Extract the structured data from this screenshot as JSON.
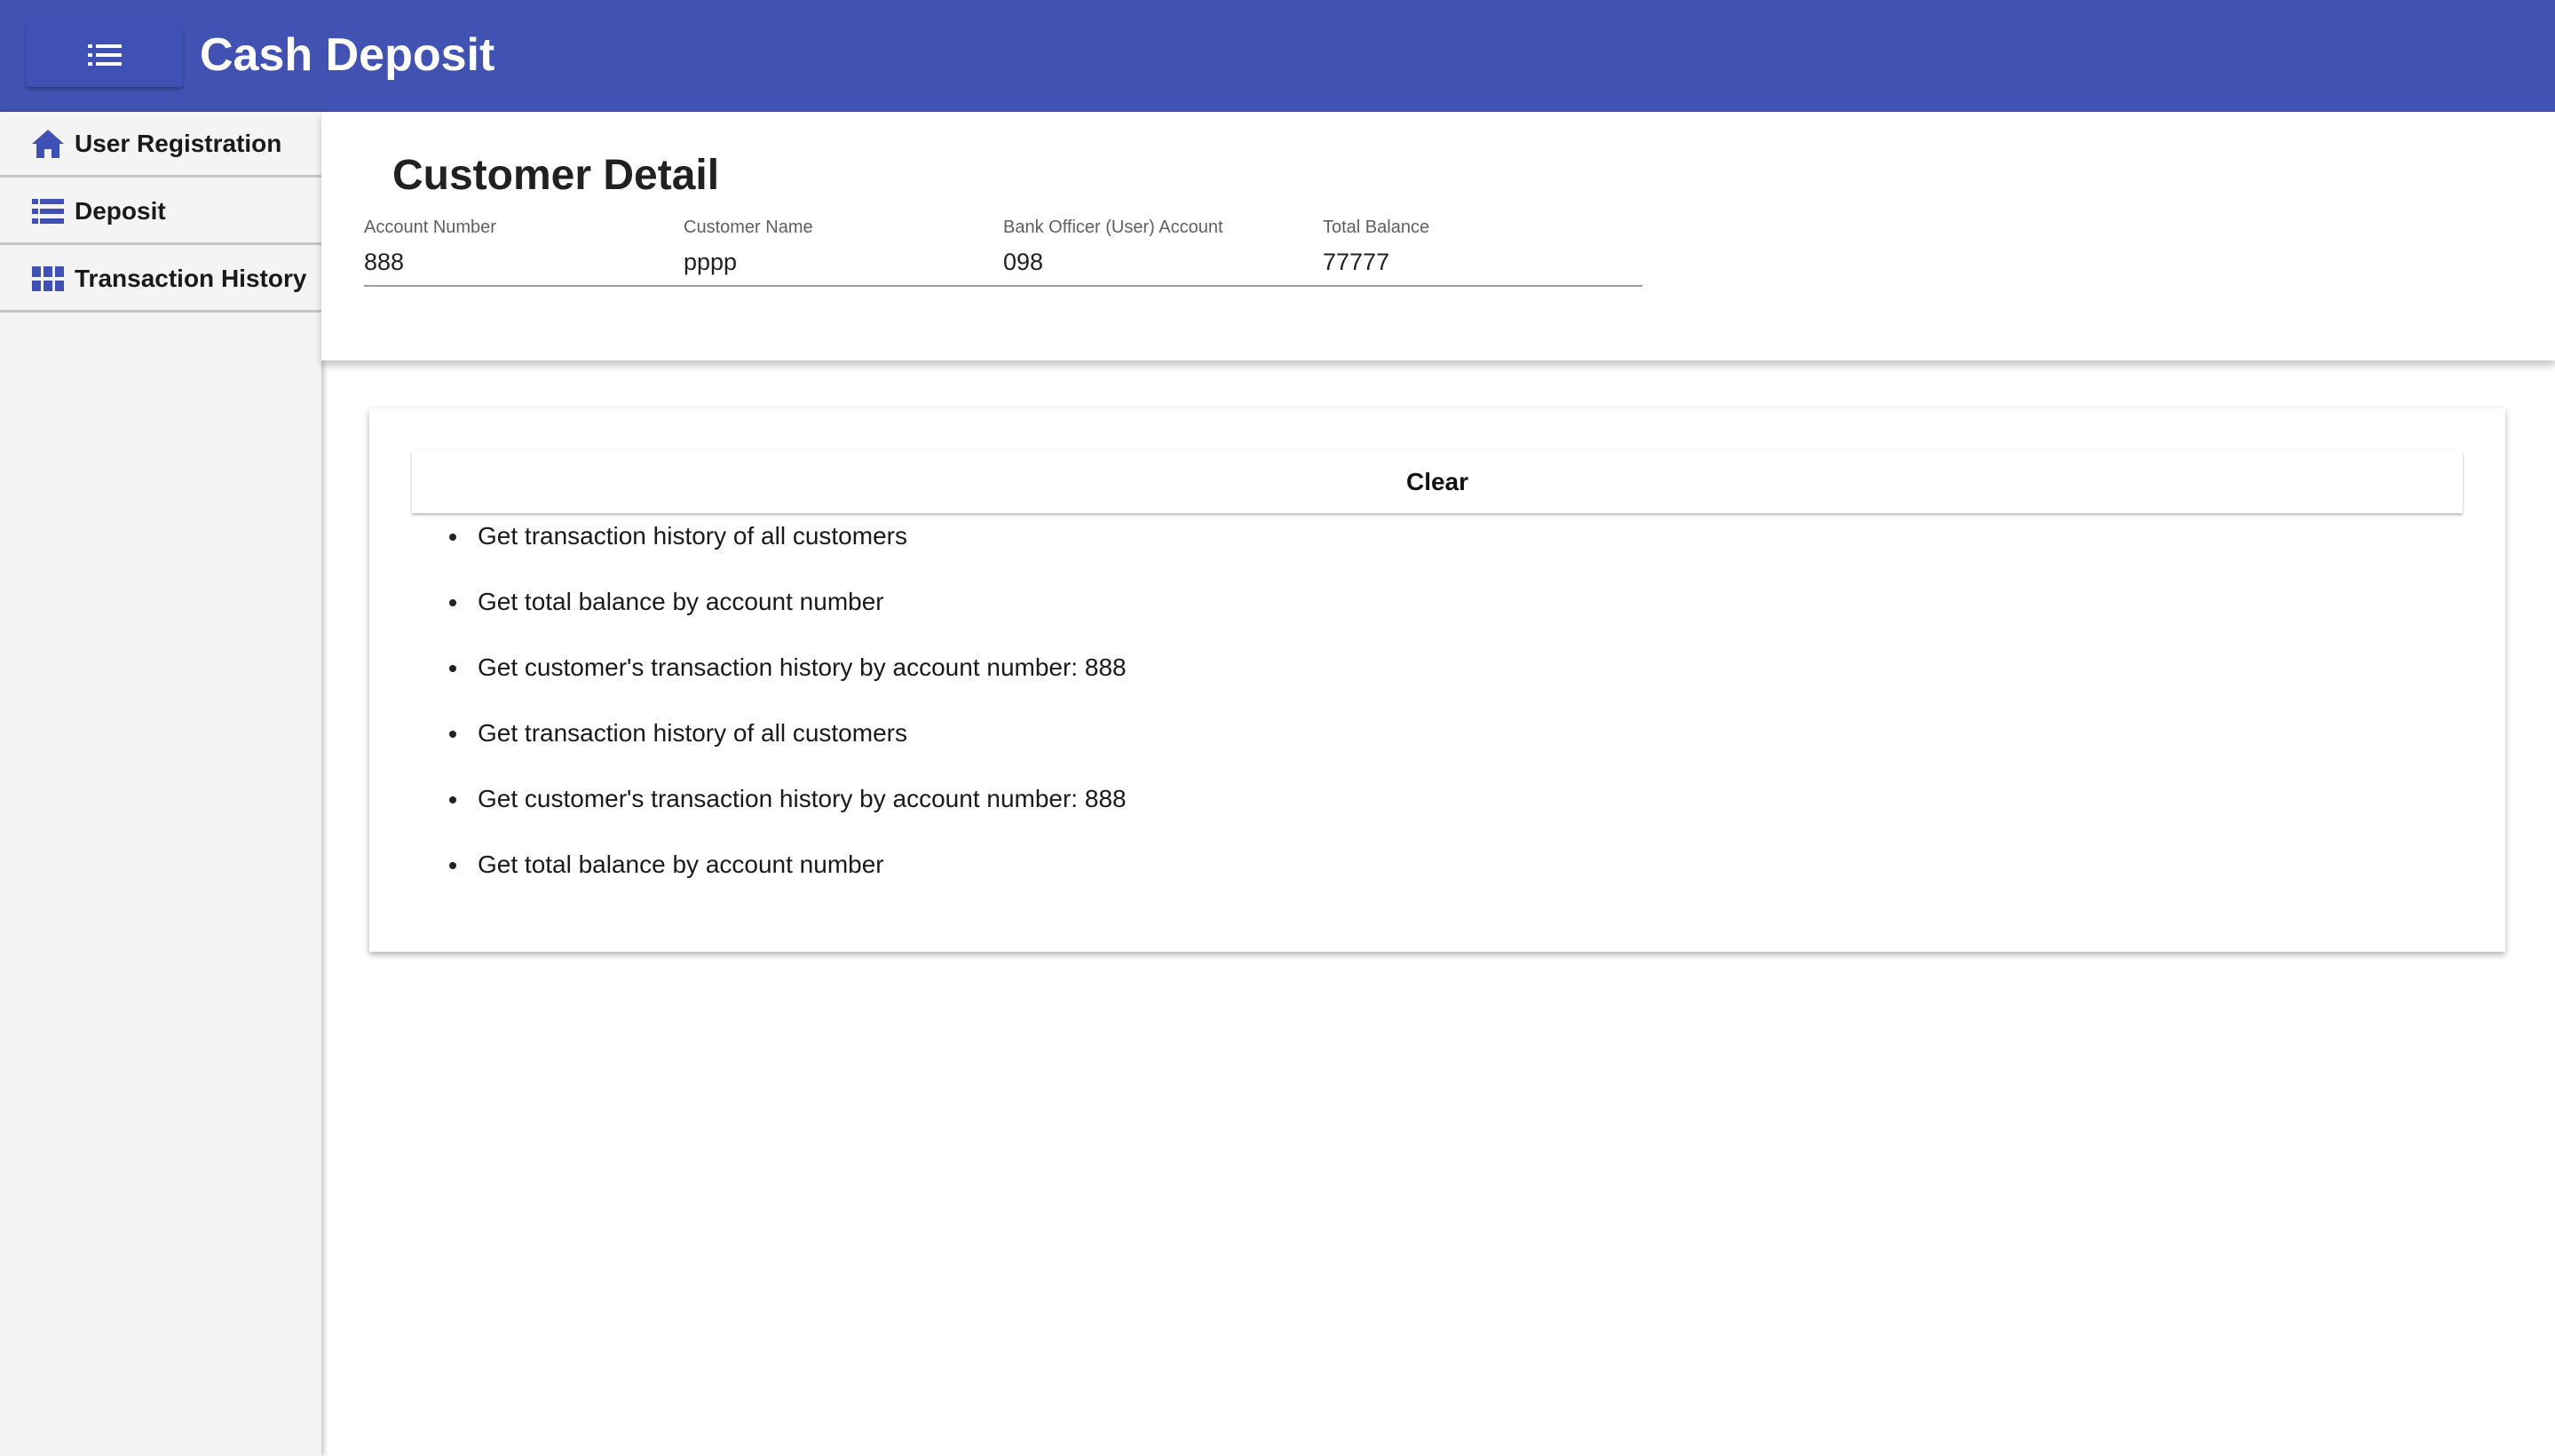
{
  "app": {
    "title": "Cash Deposit",
    "accent_color": "#4152b3",
    "menu_icon": "list-icon"
  },
  "sidebar": {
    "items": [
      {
        "label": "User Registration",
        "icon": "home-icon"
      },
      {
        "label": "Deposit",
        "icon": "list-icon"
      },
      {
        "label": "Transaction History",
        "icon": "grid-icon"
      }
    ]
  },
  "customer_detail": {
    "title": "Customer Detail",
    "fields": [
      {
        "label": "Account Number",
        "value": "888"
      },
      {
        "label": "Customer Name",
        "value": "pppp"
      },
      {
        "label": "Bank Officer (User) Account",
        "value": "098"
      },
      {
        "label": "Total Balance",
        "value": "77777"
      }
    ]
  },
  "log": {
    "clear_label": "Clear",
    "entries": [
      "Get transaction history of all customers",
      "Get total balance by account number",
      "Get customer's transaction history by account number: 888",
      "Get transaction history of all customers",
      "Get customer's transaction history by account number: 888",
      "Get total balance by account number"
    ]
  }
}
